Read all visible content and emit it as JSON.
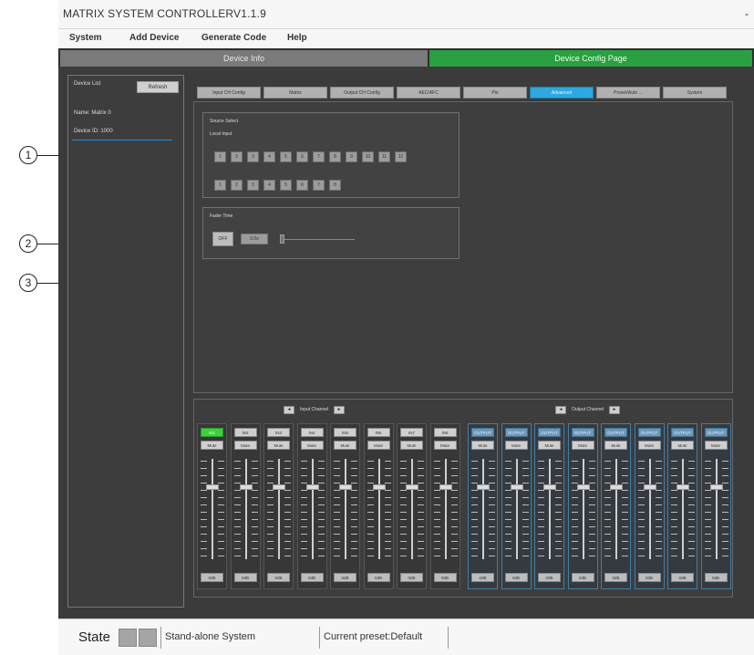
{
  "callouts": [
    "1",
    "2",
    "3"
  ],
  "app": {
    "title": "MATRIX SYSTEM CONTROLLERV1.1.9",
    "minimize": "-"
  },
  "menu": [
    "System",
    "Add Device",
    "Generate Code",
    "Help"
  ],
  "page_tabs": {
    "info": "Device Info",
    "config": "Device Config Page"
  },
  "device_list": {
    "title": "Device List",
    "refresh": "Refresh",
    "name": "Name: Matrix 0",
    "id": "Device ID: 1000"
  },
  "sub_tabs": [
    "Input CH Config",
    "Matrix",
    "Output CH Config",
    "AEC/AFC",
    "Pin",
    "Advanced",
    "Preset/Auto ... ",
    "System"
  ],
  "active_sub_tab": 5,
  "source_select": {
    "title": "Source Select",
    "subtitle": "Local Input",
    "row1": [
      "1",
      "2",
      "3",
      "4",
      "5",
      "6",
      "7",
      "8",
      "9",
      "10",
      "11",
      "12"
    ],
    "row2": [
      "1",
      "2",
      "3",
      "4",
      "5",
      "6",
      "7",
      "8"
    ]
  },
  "fader_group": {
    "title": "Fader Time",
    "off": "OFF",
    "value": "0.0s"
  },
  "mixer": {
    "input_channel_label": "Input Channel",
    "output_channel_label": "Output Channel",
    "prev": "◄",
    "next": "►",
    "input_strips": [
      {
        "top": "IN1",
        "mute": "Mute",
        "db": "0dB"
      },
      {
        "top": "IN2",
        "mute": "Mute",
        "db": "0dB"
      },
      {
        "top": "IN3",
        "mute": "Mute",
        "db": "0dB"
      },
      {
        "top": "IN4",
        "mute": "Mute",
        "db": "0dB"
      },
      {
        "top": "IN5",
        "mute": "Mute",
        "db": "0dB"
      },
      {
        "top": "IN6",
        "mute": "Mute",
        "db": "0dB"
      },
      {
        "top": "IN7",
        "mute": "Mute",
        "db": "0dB"
      },
      {
        "top": "IN8",
        "mute": "Mute",
        "db": "0dB"
      }
    ],
    "output_strips": [
      {
        "top": "OUTPUT",
        "mute": "Mute",
        "db": "0dB"
      },
      {
        "top": "OUTPUT",
        "mute": "Mute",
        "db": "0dB"
      },
      {
        "top": "OUTPUT",
        "mute": "Mute",
        "db": "0dB"
      },
      {
        "top": "OUTPUT",
        "mute": "Mute",
        "db": "0dB"
      },
      {
        "top": "OUTPUT",
        "mute": "Mute",
        "db": "0dB"
      },
      {
        "top": "OUTPUT",
        "mute": "Mute",
        "db": "0dB"
      },
      {
        "top": "OUTPUT",
        "mute": "Mute",
        "db": "0dB"
      },
      {
        "top": "OUTPUT",
        "mute": "Mute",
        "db": "0dB"
      }
    ]
  },
  "status": {
    "label": "State",
    "system": "Stand-alone System",
    "preset": "Current preset:Default"
  },
  "colors": {
    "active_tab": "#2ea8e0",
    "config_tab": "#2aa040",
    "input_active": "#3fcf3f"
  }
}
